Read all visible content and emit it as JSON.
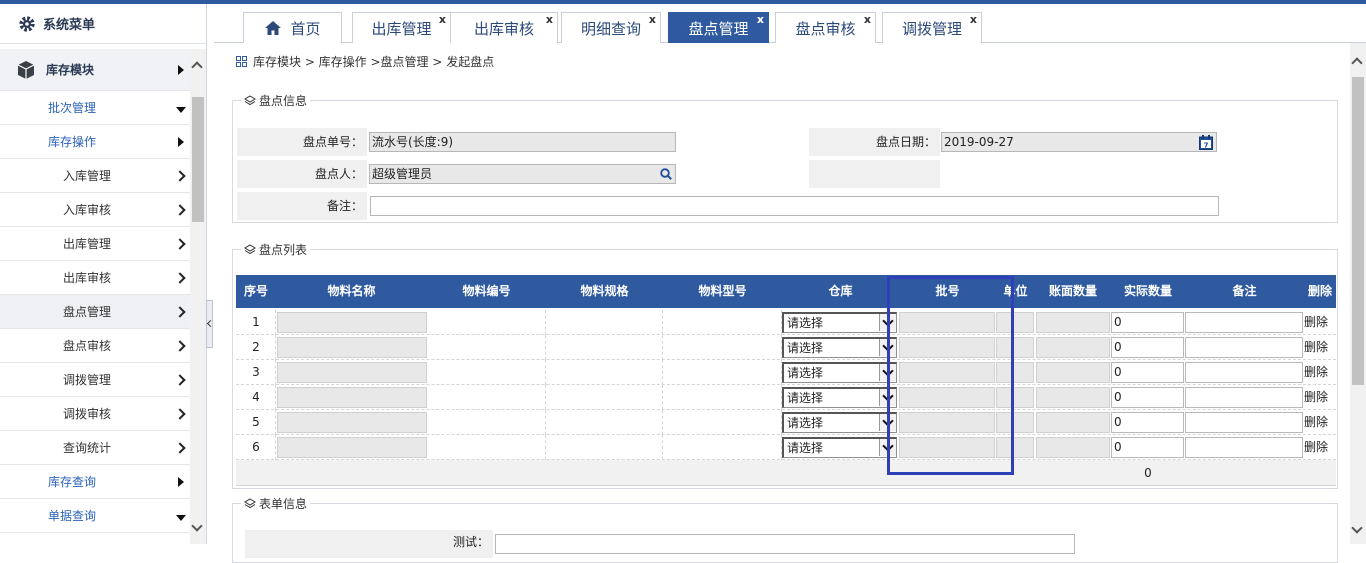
{
  "sidebar": {
    "title": "系统菜单",
    "items": [
      {
        "label": "库存模块",
        "level": 0,
        "arrow": "tri-r"
      },
      {
        "label": "批次管理",
        "level": 1,
        "arrow": "tri-d"
      },
      {
        "label": "库存操作",
        "level": 1,
        "arrow": "tri-r"
      },
      {
        "label": "入库管理",
        "level": 2,
        "arrow": "chevron"
      },
      {
        "label": "入库审核",
        "level": 2,
        "arrow": "chevron"
      },
      {
        "label": "出库管理",
        "level": 2,
        "arrow": "chevron"
      },
      {
        "label": "出库审核",
        "level": 2,
        "arrow": "chevron"
      },
      {
        "label": "盘点管理",
        "level": 2,
        "arrow": "chevron",
        "active": true
      },
      {
        "label": "盘点审核",
        "level": 2,
        "arrow": "chevron"
      },
      {
        "label": "调拨管理",
        "level": 2,
        "arrow": "chevron"
      },
      {
        "label": "调拨审核",
        "level": 2,
        "arrow": "chevron"
      },
      {
        "label": "查询统计",
        "level": 2,
        "arrow": "chevron"
      },
      {
        "label": "库存查询",
        "level": 1,
        "arrow": "tri-r"
      },
      {
        "label": "单据查询",
        "level": 1,
        "arrow": "tri-d"
      }
    ]
  },
  "tabs": [
    {
      "label": "首页",
      "closable": false
    },
    {
      "label": "出库管理",
      "closable": true
    },
    {
      "label": "出库审核",
      "closable": true
    },
    {
      "label": "明细查询",
      "closable": true
    },
    {
      "label": "盘点管理",
      "closable": true,
      "active": true
    },
    {
      "label": "盘点审核",
      "closable": true
    },
    {
      "label": "调拨管理",
      "closable": true
    }
  ],
  "close_glyph": "x",
  "breadcrumb": "库存模块 > 库存操作 >盘点管理 > 发起盘点",
  "info_panel": {
    "legend": "盘点信息",
    "order_no_label": "盘点单号：",
    "order_no_value": "流水号(长度:9)",
    "date_label": "盘点日期：",
    "date_value": "2019-09-27",
    "person_label": "盘点人：",
    "person_value": "超级管理员",
    "remark_label": "备注：",
    "remark_value": ""
  },
  "list_panel": {
    "legend": "盘点列表",
    "columns": [
      "序号",
      "物料名称",
      "物料编号",
      "物料规格",
      "物料型号",
      "仓库",
      "批号",
      "单位",
      "账面数量",
      "实际数量",
      "备注",
      "删除"
    ],
    "rows": [
      {
        "no": "1",
        "warehouse": "请选择",
        "actual": "0",
        "delete": "删除"
      },
      {
        "no": "2",
        "warehouse": "请选择",
        "actual": "0",
        "delete": "删除"
      },
      {
        "no": "3",
        "warehouse": "请选择",
        "actual": "0",
        "delete": "删除"
      },
      {
        "no": "4",
        "warehouse": "请选择",
        "actual": "0",
        "delete": "删除"
      },
      {
        "no": "5",
        "warehouse": "请选择",
        "actual": "0",
        "delete": "删除"
      },
      {
        "no": "6",
        "warehouse": "请选择",
        "actual": "0",
        "delete": "删除"
      }
    ],
    "total_actual": "0"
  },
  "form_panel": {
    "legend": "表单信息",
    "test_label": "测试："
  },
  "colors": {
    "accent": "#2f5aa0",
    "highlight": "#2e3fb8"
  }
}
